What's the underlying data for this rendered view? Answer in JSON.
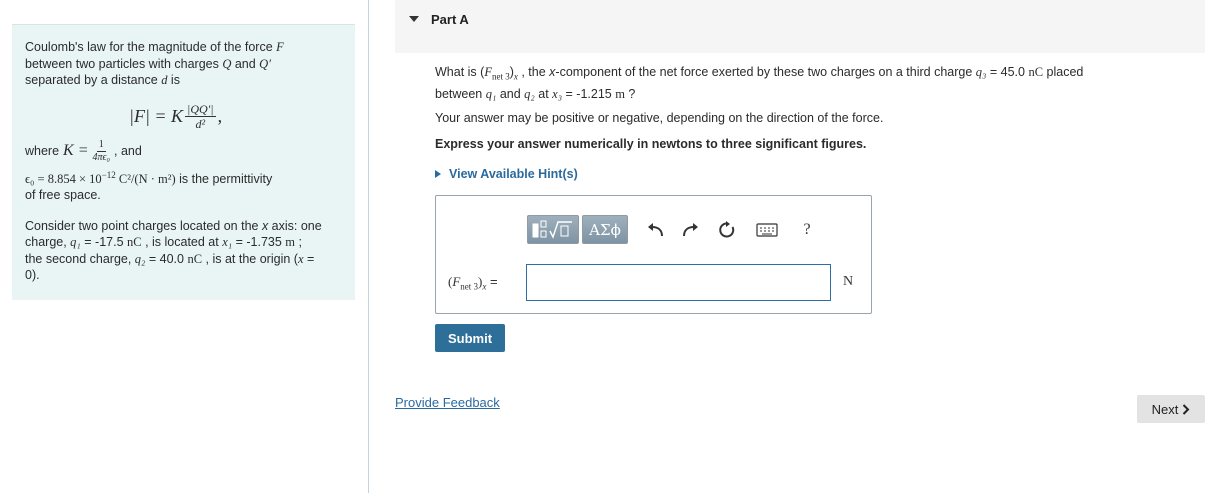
{
  "info": {
    "intro_1": "Coulomb's law for the magnitude of the force ",
    "intro_F": "F",
    "intro_2": "between two particles with charges ",
    "intro_Q": "Q",
    "intro_and": " and ",
    "intro_Qp": "Q′",
    "intro_3": "separated by a distance ",
    "intro_d": "d",
    "intro_is": " is",
    "formula_lhs": "|F| = K",
    "formula_num": "|QQ′|",
    "formula_den": "d²",
    "formula_comma": ",",
    "where": "where ",
    "K_eq": "K = ",
    "k_num": "1",
    "k_den": "4πϵ₀",
    "k_and": ", and",
    "eps": "ϵ₀ = 8.854 × 10",
    "eps_exp": "−12",
    "eps_units": " C²/(N · m²)",
    "eps_text": " is the permittivity",
    "eps_text2": "of free space.",
    "consider_1": "Consider two point charges located on the ",
    "consider_x": "x",
    "consider_2": " axis: one",
    "consider_3": "charge, ",
    "q1": "q₁",
    "q1_val": " = -17.5 ",
    "nC": "nC",
    "q1_loc": " , is located at ",
    "x1": "x₁",
    "x1_val": " = -1.735 ",
    "m": "m",
    "semicolon": " ;",
    "consider_4": "the second charge, ",
    "q2": "q₂",
    "q2_val": " = 40.0 ",
    "q2_loc": " , is at the origin (",
    "x_eq0": "x",
    "eq": " =",
    "zero": "0)."
  },
  "part": {
    "title": "Part A"
  },
  "question": {
    "q_what": "What is (",
    "q_F": "F",
    "q_net": "net 3",
    "q_close": ")",
    "q_x": "x",
    "q_rest1": " , the ",
    "q_xcomp": "x",
    "q_rest2": "-component of the net force exerted by these two charges on a third charge ",
    "q_q3": "q₃",
    "q_q3val": " = 45.0 ",
    "q_nC": "nC",
    "q_placed": " placed",
    "q_between": "between ",
    "q_q1": "q₁",
    "q_and": " and ",
    "q_q2": "q₂",
    "q_at": " at ",
    "q_x3": "x₃",
    "q_x3val": " = -1.215 ",
    "q_m": "m",
    "q_qmark": " ?",
    "note": "Your answer may be positive or negative, depending on the direction of the force.",
    "instruction": "Express your answer numerically in newtons to three significant figures.",
    "hints": "View Available Hint(s)"
  },
  "answer": {
    "label_open": "(",
    "label_F": "F",
    "label_net": "net 3",
    "label_close": ")",
    "label_x": "x",
    "label_eq": " =",
    "value": "",
    "unit": "N",
    "greek_label": "ΑΣϕ",
    "help_label": "?"
  },
  "actions": {
    "submit": "Submit",
    "feedback": "Provide Feedback",
    "next": "Next"
  },
  "icons": [
    "template-math-icon",
    "greek-symbols-icon",
    "undo-icon",
    "redo-icon",
    "reset-icon",
    "keyboard-icon",
    "help-icon",
    "chevron-right-icon",
    "caret-down-icon",
    "caret-right-icon"
  ],
  "colors": {
    "panel_bg": "#e9f5f5",
    "link": "#2b6a9e",
    "submit_bg": "#2d6f99",
    "input_border": "#2f6ea2"
  }
}
